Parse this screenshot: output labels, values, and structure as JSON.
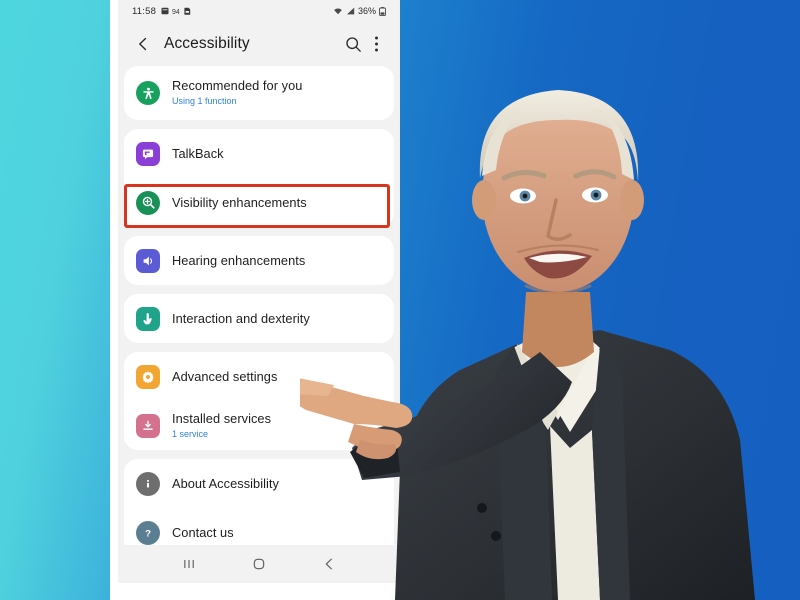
{
  "background": {
    "gradient_from": "#4ED6DF",
    "gradient_to": "#1560C0"
  },
  "phone": {
    "status_bar": {
      "time": "11:58",
      "battery_percent": "36%",
      "icons": [
        "calendar-icon",
        "dual-sim-icon",
        "sd-card-icon",
        "wifi-icon",
        "signal-icon",
        "battery-icon"
      ]
    },
    "action_bar": {
      "title": "Accessibility",
      "back_icon": "chevron-left-icon",
      "search_icon": "search-icon",
      "overflow_icon": "more-vertical-icon"
    },
    "groups": [
      {
        "id": "recommended",
        "items": [
          {
            "title": "Recommended for you",
            "subtitle": "Using 1 function",
            "icon": "accessibility-person-icon",
            "icon_color": "#17A05E",
            "icon_shape": "circle",
            "highlighted": false
          }
        ]
      },
      {
        "id": "main-features",
        "items": [
          {
            "title": "TalkBack",
            "subtitle": "",
            "icon": "speech-bubble-icon",
            "icon_color": "#8B3FD6",
            "icon_shape": "squircle",
            "highlighted": false
          },
          {
            "title": "Visibility enhancements",
            "subtitle": "",
            "icon": "magnifier-plus-icon",
            "icon_color": "#179158",
            "icon_shape": "circle",
            "highlighted": true
          }
        ]
      },
      {
        "id": "hearing",
        "items": [
          {
            "title": "Hearing enhancements",
            "subtitle": "",
            "icon": "speaker-icon",
            "icon_color": "#5B5BD6",
            "icon_shape": "squircle",
            "highlighted": false
          }
        ]
      },
      {
        "id": "interaction",
        "items": [
          {
            "title": "Interaction and dexterity",
            "subtitle": "",
            "icon": "tap-hand-icon",
            "icon_color": "#1FA38A",
            "icon_shape": "squircle",
            "highlighted": false
          }
        ]
      },
      {
        "id": "advanced",
        "items": [
          {
            "title": "Advanced settings",
            "subtitle": "",
            "icon": "gear-icon",
            "icon_color": "#F3A534",
            "icon_shape": "squircle",
            "highlighted": false
          },
          {
            "title": "Installed services",
            "subtitle": "1 service",
            "icon": "download-box-icon",
            "icon_color": "#D4718E",
            "icon_shape": "squircle",
            "highlighted": false
          }
        ]
      },
      {
        "id": "about",
        "items": [
          {
            "title": "About Accessibility",
            "subtitle": "",
            "icon": "info-icon",
            "icon_color": "#6E6E6E",
            "icon_shape": "circle",
            "highlighted": false
          },
          {
            "title": "Contact us",
            "subtitle": "",
            "icon": "question-mark-icon",
            "icon_color": "#5B7E93",
            "icon_shape": "circle",
            "highlighted": false
          }
        ]
      }
    ],
    "nav_bar": {
      "recents_icon": "recents-icon",
      "home_icon": "home-icon",
      "back_icon": "back-icon"
    },
    "highlight": {
      "target": "Visibility enhancements",
      "color": "#D8351F"
    }
  },
  "person": {
    "description": "presenter-pointing-at-phone",
    "hair_color": "#E3DCCF",
    "skin_color": "#D9A183",
    "suit_color": "#2F3338",
    "shirt_color": "#EFEDE2"
  }
}
